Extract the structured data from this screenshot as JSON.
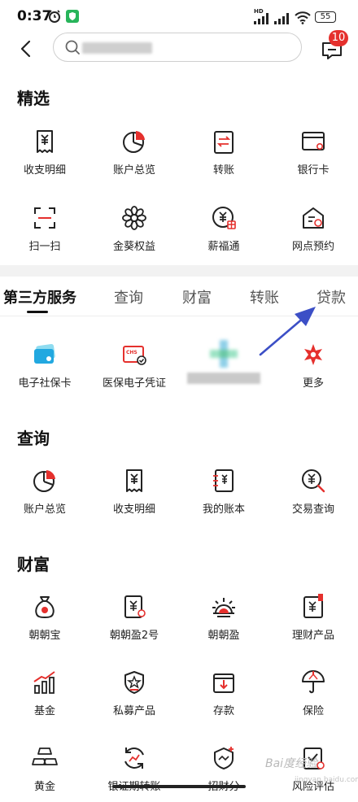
{
  "status_bar": {
    "time": "0:37",
    "battery": "55",
    "network": "HD"
  },
  "header": {
    "search_placeholder": "",
    "message_badge": "10"
  },
  "featured": {
    "title": "精选",
    "items": [
      {
        "label": "收支明细",
        "icon": "receipt-yuan-icon"
      },
      {
        "label": "账户总览",
        "icon": "pie-chart-icon"
      },
      {
        "label": "转账",
        "icon": "transfer-icon"
      },
      {
        "label": "银行卡",
        "icon": "bank-card-icon"
      },
      {
        "label": "扫一扫",
        "icon": "scan-icon"
      },
      {
        "label": "金葵权益",
        "icon": "sunflower-icon"
      },
      {
        "label": "薪福通",
        "icon": "salary-icon"
      },
      {
        "label": "网点预约",
        "icon": "branch-booking-icon"
      }
    ]
  },
  "tabs": [
    {
      "label": "第三方服务",
      "active": true
    },
    {
      "label": "查询",
      "active": false
    },
    {
      "label": "财富",
      "active": false
    },
    {
      "label": "转账",
      "active": false
    },
    {
      "label": "贷款",
      "active": false
    }
  ],
  "third_party": {
    "items": [
      {
        "label": "电子社保卡",
        "icon": "social-security-card-icon"
      },
      {
        "label": "医保电子凭证",
        "icon": "medical-insurance-card-icon"
      },
      {
        "label": "",
        "icon": "blurred-cross-icon"
      },
      {
        "label": "更多",
        "icon": "more-star-icon"
      }
    ]
  },
  "query": {
    "title": "查询",
    "items": [
      {
        "label": "账户总览",
        "icon": "pie-chart-icon"
      },
      {
        "label": "收支明细",
        "icon": "receipt-yuan-icon"
      },
      {
        "label": "我的账本",
        "icon": "ledger-icon"
      },
      {
        "label": "交易查询",
        "icon": "search-yuan-icon"
      }
    ]
  },
  "wealth": {
    "title": "财富",
    "items": [
      {
        "label": "朝朝宝",
        "icon": "money-bag-icon"
      },
      {
        "label": "朝朝盈2号",
        "icon": "document-yuan-icon"
      },
      {
        "label": "朝朝盈",
        "icon": "sunrise-icon"
      },
      {
        "label": "理财产品",
        "icon": "finance-product-icon"
      },
      {
        "label": "基金",
        "icon": "bar-chart-icon"
      },
      {
        "label": "私募产品",
        "icon": "shield-star-icon"
      },
      {
        "label": "存款",
        "icon": "deposit-icon"
      },
      {
        "label": "保险",
        "icon": "umbrella-icon"
      }
    ],
    "partial_items": [
      {
        "label": "黄金",
        "icon": "gold-bars-icon"
      },
      {
        "label": "银证期转账",
        "icon": "refresh-icon"
      },
      {
        "label": "招财分",
        "icon": "shield-plus-icon"
      },
      {
        "label": "风险评估",
        "icon": "clipboard-icon"
      }
    ]
  },
  "watermark": {
    "text": "Bai度经验",
    "sub": "jingyan.baidu.com"
  },
  "colors": {
    "accent_red": "#e5302d",
    "annotation_arrow": "#3c4fc6"
  }
}
